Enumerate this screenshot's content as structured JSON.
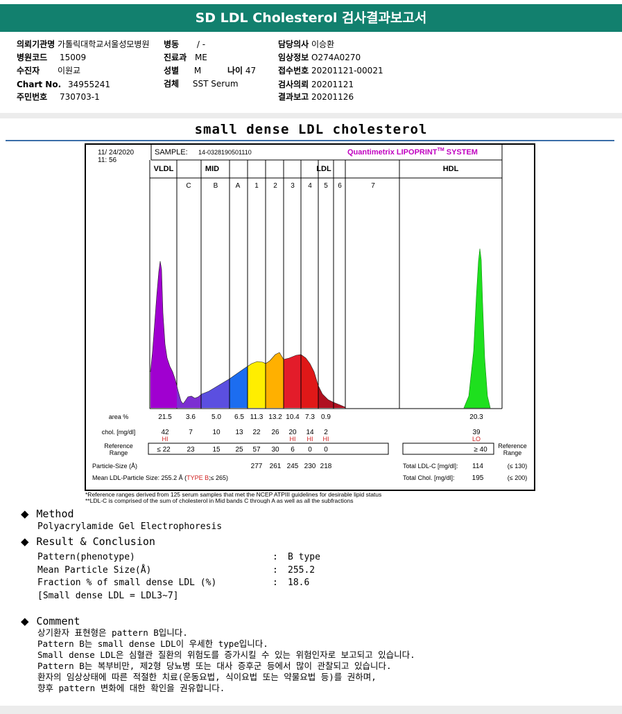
{
  "header": {
    "title": "SD LDL Cholesterol 검사결과보고서"
  },
  "patient": {
    "institution_label": "의뢰기관명",
    "institution": "가톨릭대학교서울성모병원",
    "ward_label": "병동",
    "ward": "/ -",
    "doctor_label": "담당의사",
    "doctor": "이승환",
    "hospital_code_label": "병원코드",
    "hospital_code": "15009",
    "dept_label": "진료과",
    "dept": "ME",
    "clinical_info_label": "임상정보",
    "clinical_info": "O274A0270",
    "name_label": "수진자",
    "name": "이원교",
    "sex_label": "성별",
    "sex": "M",
    "age_label": "나이",
    "age": "47",
    "receipt_label": "접수번호",
    "receipt": "20201121-00021",
    "chart_no_label": "Chart No.",
    "chart_no": "34955241",
    "specimen_label": "검체",
    "specimen": "SST Serum",
    "request_date_label": "검사의뢰",
    "request_date": "20201121",
    "report_date_label": "결과보고",
    "report_date": "20201126",
    "resident_no_label": "주민번호",
    "resident_no": "730703-1"
  },
  "section_title": "small dense LDL cholesterol",
  "report": {
    "date": "11/ 24/2020",
    "time": "11: 56",
    "sample_label": "SAMPLE:",
    "sample_id": "14-0328190501110",
    "brand": "Quantimetrix LIPOPRINT",
    "brand_tm": "TM",
    "brand_suffix": " SYSTEM",
    "groups": {
      "vldl": "VLDL",
      "mid": "MID",
      "ldl": "LDL",
      "hdl": "HDL"
    },
    "bands": [
      "C",
      "B",
      "A",
      "1",
      "2",
      "3",
      "4",
      "5",
      "6",
      "7"
    ],
    "row_labels": {
      "area": "area %",
      "chol": "chol. [mg/dl]",
      "ref": "Reference\nRange",
      "ref_right": "Reference\nRange",
      "size": "Particle-Size (Å)",
      "mean": "Mean LDL-Particle Size:"
    },
    "area": {
      "vldl": "21.5",
      "C": "3.6",
      "B": "5.0",
      "A": "6.5",
      "1": "11.3",
      "2": "13.2",
      "3": "10.4",
      "4": "7.3",
      "5": "0.9",
      "hdl": "20.3"
    },
    "chol": {
      "vldl": "42",
      "C": "7",
      "B": "10",
      "A": "13",
      "1": "22",
      "2": "26",
      "3": "20",
      "4": "14",
      "5": "2",
      "hdl": "39"
    },
    "flags": {
      "vldl": "HI",
      "3": "HI",
      "4": "HI",
      "5": "HI",
      "hdl": "LO"
    },
    "ref": {
      "vldl": "≤ 22",
      "C": "23",
      "B": "15",
      "A": "25",
      "1": "57",
      "2": "30",
      "3": "6",
      "4": "0",
      "5": "0",
      "hdl": "≥ 40"
    },
    "size": {
      "1": "277",
      "2": "261",
      "3": "245",
      "4": "230",
      "5": "218"
    },
    "mean_value": "255.2 Å",
    "mean_type_open": "(",
    "mean_type": "TYPE B",
    "mean_type_close": ";≤ 265)",
    "total_ldl_label": "Total LDL-C [mg/dl]:",
    "total_ldl": "114",
    "total_ldl_ref": "(≤ 130)",
    "total_chol_label": "Total Chol. [mg/dl]:",
    "total_chol": "195",
    "total_chol_ref": "(≤ 200)",
    "footnote1": "*Reference ranges derived from 125 serum samples that met the NCEP ATPIII guidelines for desirable lipid status",
    "footnote2": "**LDL-C is comprised of the sum of cholesterol in Mid bands C through A as well as all the subfractions"
  },
  "method": {
    "heading": "Method",
    "text": "Polyacrylamide Gel Electrophoresis"
  },
  "result": {
    "heading": "Result & Conclusion",
    "rows": [
      {
        "label": "Pattern(phenotype)",
        "colon": ":",
        "value": "B type"
      },
      {
        "label": "Mean Particle Size(Å)",
        "colon": ":",
        "value": "255.2"
      },
      {
        "label": "Fraction % of small dense LDL (%)",
        "colon": ":",
        "value": "18.6"
      }
    ],
    "note": "[Small dense LDL = LDL3~7]"
  },
  "comment": {
    "heading": "Comment",
    "lines": [
      "상기환자 표현형은 pattern B입니다.",
      "Pattern B는 small dense LDL이 우세한 type입니다.",
      "Small dense LDL은 심혈관 질환의 위험도를 증가시킬 수 있는 위험인자로 보고되고 있습니다.",
      "Pattern B는 복부비만, 제2형 당뇨병 또는 대사 증후군 등에서 많이 관찰되고 있습니다.",
      "환자의 임상상태에 따른 적절한 치료(운동요법, 식이요법 또는 약물요법 등)를 권하며,",
      "향후 pattern 변화에 대한 확인을 권유합니다."
    ]
  },
  "colors": {
    "header": "#12806e",
    "vldl": "#a000d0",
    "mid_c": "#7c2fd2",
    "mid_b": "#5b4fe0",
    "mid_a": "#1c6df0",
    "ldl1": "#ffee00",
    "ldl2": "#ffb000",
    "ldl3": "#e31c2a",
    "ldl4": "#e01818",
    "ldl5": "#b01020",
    "hdl": "#1ee01e",
    "flag": "#d02020",
    "brand": "#c000c0"
  }
}
